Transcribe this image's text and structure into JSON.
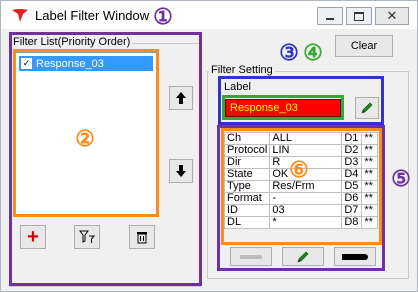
{
  "window": {
    "title": "Label Filter Window",
    "minimize_icon": "minimize-icon",
    "maximize_icon": "maximize-icon",
    "close_icon": "close-icon"
  },
  "filter_list": {
    "group_label": "Filter List(Priority Order)",
    "items": [
      {
        "label": "Response_03",
        "checked": true,
        "selected": true
      }
    ],
    "buttons": {
      "add_icon": "plus-icon",
      "filter_icon": "filter-icon",
      "delete_icon": "trash-icon",
      "up_icon": "arrow-up-icon",
      "down_icon": "arrow-down-icon"
    }
  },
  "toolbar": {
    "clear_label": "Clear"
  },
  "filter_setting": {
    "group_label": "Filter Setting",
    "label_caption": "Label",
    "label_value": "Response_03",
    "rows": [
      {
        "name": "Ch",
        "value": "ALL",
        "code": "D1",
        "mark": "**"
      },
      {
        "name": "Protocol",
        "value": "LIN",
        "code": "D2",
        "mark": "**"
      },
      {
        "name": "Dir",
        "value": "R",
        "code": "D3",
        "mark": "**"
      },
      {
        "name": "State",
        "value": "OK",
        "code": "D4",
        "mark": "**"
      },
      {
        "name": "Type",
        "value": "Res/Frm",
        "code": "D5",
        "mark": "**"
      },
      {
        "name": "Format",
        "value": "-",
        "code": "D6",
        "mark": "**"
      },
      {
        "name": "ID",
        "value": "03",
        "code": "D7",
        "mark": "**"
      },
      {
        "name": "DL",
        "value": "*",
        "code": "D8",
        "mark": "**"
      }
    ]
  },
  "annotations": {
    "n1": "①",
    "n2": "②",
    "n3": "③",
    "n4": "④",
    "n5": "⑤",
    "n6": "⑥"
  },
  "colors": {
    "purple": "#7030a0",
    "orange": "#ff8c1a",
    "blue": "#3333cc",
    "green": "#33aa33",
    "selection": "#3399ff"
  }
}
